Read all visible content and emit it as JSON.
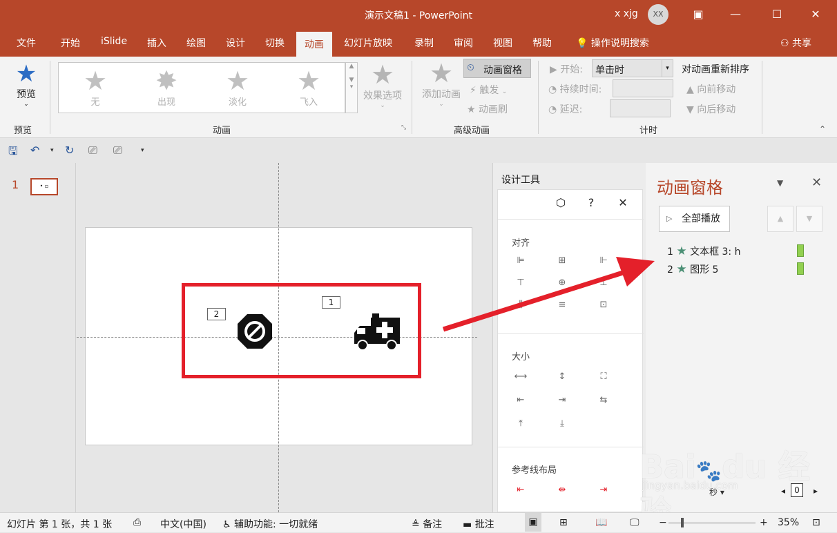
{
  "titlebar": {
    "title": "演示文稿1  -  PowerPoint",
    "user": "x xjg",
    "avatar": "XX"
  },
  "tabs": [
    "文件",
    "开始",
    "iSlide",
    "插入",
    "绘图",
    "设计",
    "切换",
    "动画",
    "幻灯片放映",
    "录制",
    "审阅",
    "视图",
    "帮助"
  ],
  "active_tab": "动画",
  "tell_me": "操作说明搜索",
  "share": "共享",
  "ribbon": {
    "preview": "预览",
    "preview_group": "预览",
    "gallery": [
      "无",
      "出现",
      "淡化",
      "飞入"
    ],
    "effect_options": "效果选项",
    "animation_group": "动画",
    "add_animation": "添加动画",
    "animation_pane": "动画窗格",
    "trigger": "触发",
    "animation_painter": "动画刷",
    "advanced_group": "高级动画",
    "start_label": "开始:",
    "start_value": "单击时",
    "duration_label": "持续时间:",
    "delay_label": "延迟:",
    "timing_group": "计时",
    "reorder": "对动画重新排序",
    "move_earlier": "向前移动",
    "move_later": "向后移动"
  },
  "thumbnail": {
    "number": "1"
  },
  "slide": {
    "tag1": "1",
    "tag2": "2"
  },
  "design_tools": {
    "title": "设计工具",
    "align": "对齐",
    "size": "大小",
    "guides": "参考线布局"
  },
  "animation_pane": {
    "title": "动画窗格",
    "play_all": "全部播放",
    "items": [
      {
        "num": "1",
        "label": "文本框 3: h"
      },
      {
        "num": "2",
        "label": "图形 5"
      }
    ],
    "seconds": "秒",
    "zoom_box": "0"
  },
  "statusbar": {
    "slide_info": "幻灯片 第 1 张，共 1 张",
    "language": "中文(中国)",
    "accessibility": "辅助功能: 一切就绪",
    "notes": "备注",
    "comments": "批注",
    "zoom": "35%"
  },
  "watermark": {
    "text": "Bai du 经验",
    "url": "jingyan.baidu.com"
  },
  "colors": {
    "accent": "#b7472a",
    "highlight": "#e4202a",
    "anim_star": "#4b8f75",
    "timeline_bar": "#92d050"
  }
}
